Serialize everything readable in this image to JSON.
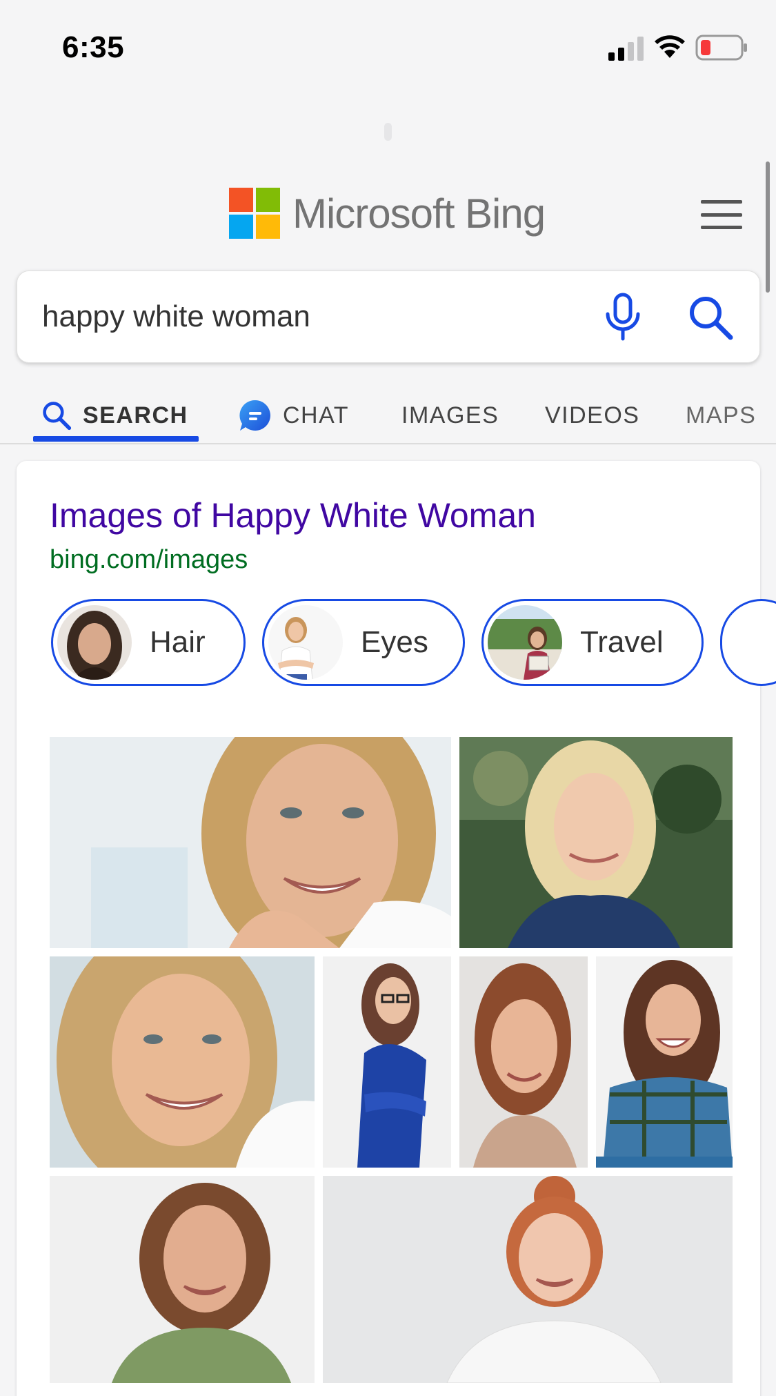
{
  "status_bar": {
    "time": "6:35",
    "icons": [
      "signal-icon",
      "wifi-icon",
      "battery-icon"
    ],
    "battery_color": "#f6393a"
  },
  "header": {
    "logo_text": "Microsoft Bing",
    "logo_colors": [
      "#f35325",
      "#81bc06",
      "#05a6f0",
      "#ffba08"
    ],
    "menu_icon": "hamburger-menu-icon"
  },
  "search": {
    "query": "happy white woman",
    "mic_icon": "microphone-icon",
    "search_icon": "search-icon",
    "accent_color": "#174ae4"
  },
  "tabs": [
    {
      "label": "SEARCH",
      "active": true,
      "icon": "search-icon"
    },
    {
      "label": "CHAT",
      "active": false,
      "icon": "chat-bubble-icon"
    },
    {
      "label": "IMAGES",
      "active": false
    },
    {
      "label": "VIDEOS",
      "active": false
    },
    {
      "label": "MAPS",
      "active": false
    }
  ],
  "result": {
    "title": "Images of Happy White Woman",
    "url": "bing.com/images",
    "title_color": "#4007a2",
    "url_color": "#006d21",
    "chips": [
      {
        "label": "Hair"
      },
      {
        "label": "Eyes"
      },
      {
        "label": "Travel"
      }
    ],
    "images": [
      "smiling-blonde-woman-portrait",
      "blonde-woman-outdoors-portrait",
      "smiling-blonde-woman-closeup",
      "woman-in-glasses-blue-shirt",
      "freckled-redhead-woman",
      "brunette-woman-plaid-shirt",
      "brunette-woman-green-top",
      "redhead-woman-white-tshirt"
    ]
  }
}
